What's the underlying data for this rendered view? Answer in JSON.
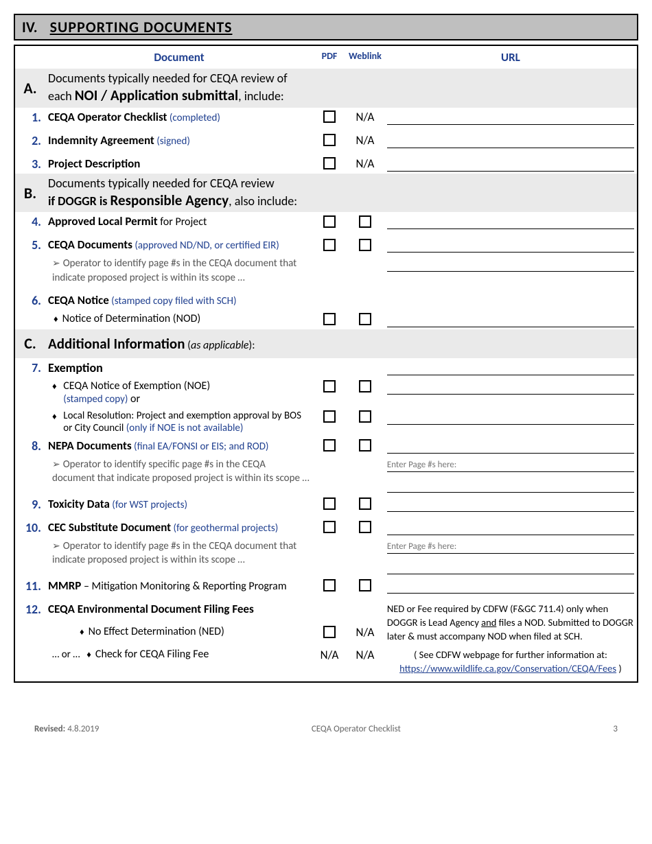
{
  "section": {
    "roman": "IV.",
    "title": "SUPPORTING DOCUMENTS"
  },
  "headers": {
    "document": "Document",
    "pdf": "PDF",
    "weblink": "Weblink",
    "url": "URL"
  },
  "groupA": {
    "letter": "A.",
    "line1": "Documents typically needed for CEQA review of",
    "line2_prefix": "each ",
    "line2_emph": "NOI / Application submittal",
    "line2_suffix": ", include:"
  },
  "row1": {
    "num": "1.",
    "bold": "CEQA Operator Checklist",
    "note": " (completed)",
    "weblink": "N/A"
  },
  "row2": {
    "num": "2.",
    "bold": "Indemnity Agreement",
    "note": " (signed)",
    "weblink": "N/A"
  },
  "row3": {
    "num": "3.",
    "bold": "Project Description",
    "note": "",
    "weblink": "N/A"
  },
  "groupB": {
    "letter": "B.",
    "line1": "Documents typically needed for CEQA review",
    "line2_prefix": "if DOGGR is ",
    "line2_emph": "Responsible Agency",
    "line2_suffix": ", also include:"
  },
  "row4": {
    "num": "4.",
    "bold": "Approved Local Permit",
    "rest": " for Project"
  },
  "row5": {
    "num": "5.",
    "bold": "CEQA Documents",
    "note": "  (approved ND/ND, or certified EIR)",
    "sub": "Operator to identify page #s in the CEQA document that indicate proposed project is within its scope …"
  },
  "row6": {
    "num": "6.",
    "bold": "CEQA Notice",
    "note": " (stamped copy filed with SCH)",
    "bullet": "Notice of Determination (NOD)"
  },
  "groupC": {
    "letter": "C.",
    "emph": "Additional Information",
    "rest_italic": "as applicable",
    "suffix": "):"
  },
  "row7": {
    "num": "7.",
    "title": "Exemption",
    "b1_a": "CEQA Notice of Exemption (NOE)",
    "b1_b": "(stamped copy)",
    "b1_c": " or",
    "b2_a": "Local Resolution:",
    "b2_b": " Project and exemption approval by BOS or City Council ",
    "b2_c": "(only if NOE is not available)"
  },
  "row8": {
    "num": "8.",
    "bold": "NEPA Documents",
    "note": "  (final EA/FONSI or EIS; and ROD)",
    "sub": "Operator to identify specific page #s in the CEQA document   that indicate proposed project is within its scope …",
    "placeholder": "Enter Page #s here:"
  },
  "row9": {
    "num": "9.",
    "bold": "Toxicity Data",
    "note": " (for WST projects)"
  },
  "row10": {
    "num": "10.",
    "bold": "CEC Substitute Document",
    "note": " (for geothermal projects)",
    "sub": "Operator to identify page #s in the CEQA document that indicate proposed project is within its scope …",
    "placeholder": "Enter Page #s here:"
  },
  "row11": {
    "num": "11.",
    "bold": "MMRP",
    "rest": " – Mitigation Monitoring & Reporting Program"
  },
  "row12": {
    "num": "12.",
    "bold": "CEQA Environmental Document Filing Fees",
    "fee_line1": "NED or Fee required by CDFW (F&GC 711.4) only when DOGGR is Lead Agency ",
    "fee_and": "and",
    "fee_line1b": " files a NOD.  Submitted to DOGGR later & must accompany NOD when filed at SCH.",
    "bullet1": "No Effect Determination (NED)",
    "bullet1_web": "N/A",
    "or_prefix": "… or …",
    "bullet2": "Check for CEQA Filing Fee",
    "bullet2_pdf": "N/A",
    "bullet2_web": "N/A",
    "see_prefix": "( See CDFW webpage for further information at:",
    "link": "https://www.wildlife.ca.gov/Conservation/CEQA/Fees",
    "see_suffix": " )"
  },
  "footer": {
    "revised_label": "Revised:",
    "revised_date": "  4.8.2019",
    "center": "CEQA Operator Checklist",
    "page": "3"
  }
}
